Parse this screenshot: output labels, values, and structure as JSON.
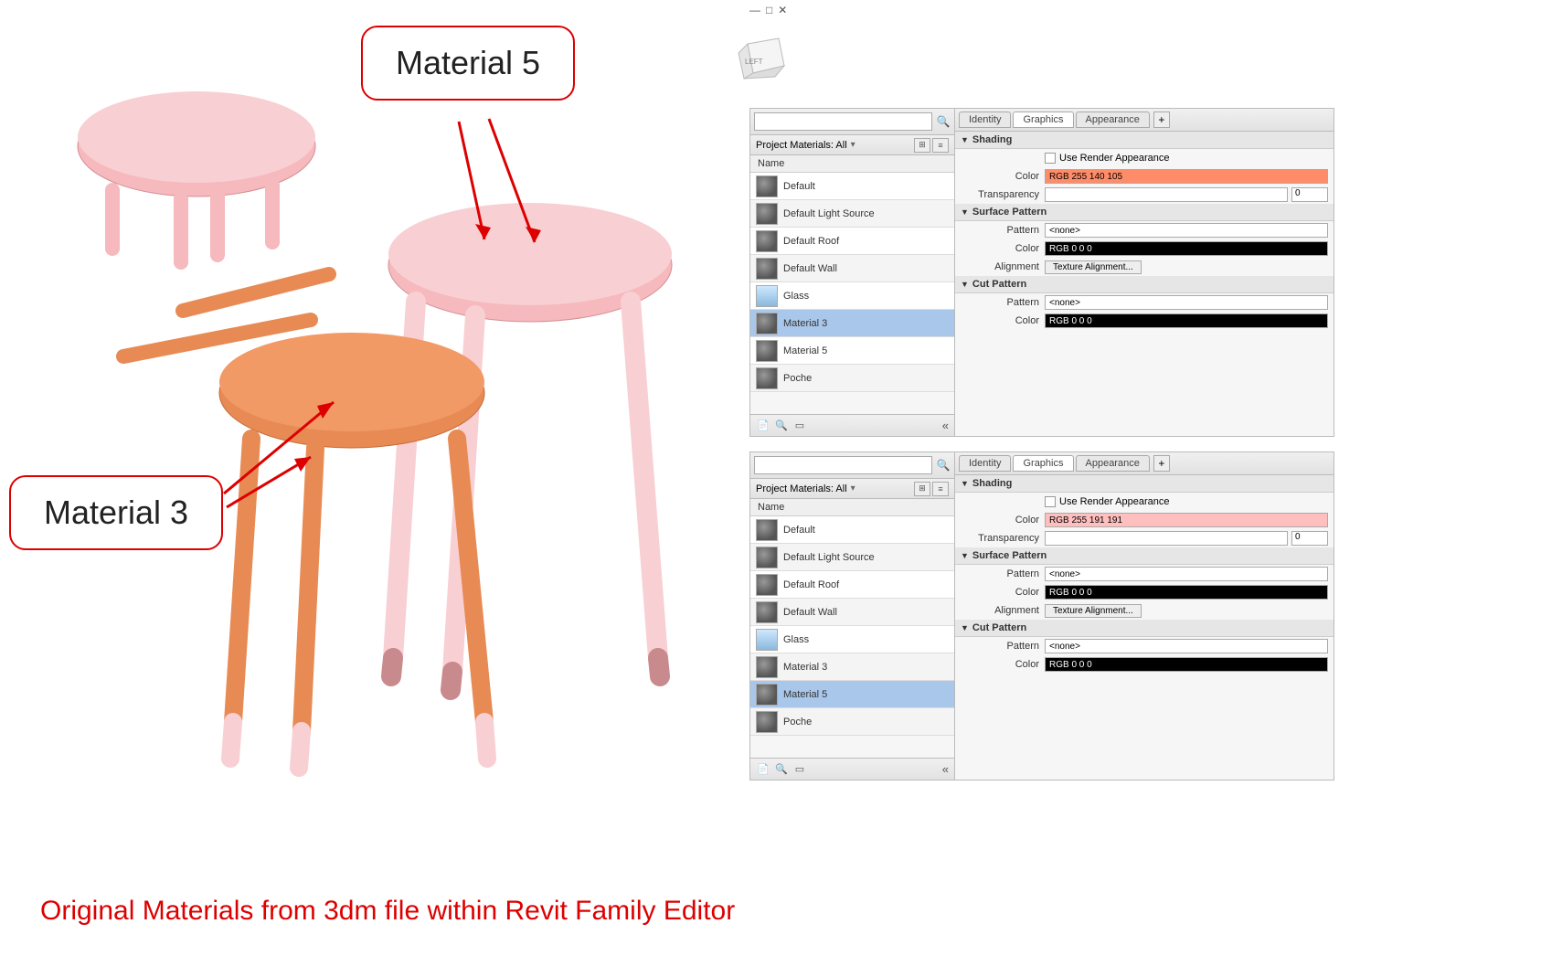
{
  "callouts": {
    "mat5": "Material 5",
    "mat3": "Material 3"
  },
  "caption": "Original Materials from 3dm file within Revit Family Editor",
  "window_ctrls": [
    "—",
    "□",
    "✕"
  ],
  "viewcube": {
    "face": "LEFT"
  },
  "search": {
    "placeholder": ""
  },
  "filter": {
    "label": "Project Materials: All",
    "chev": "▾"
  },
  "list_header": "Name",
  "materials": [
    {
      "name": "Default",
      "sw": "sphere"
    },
    {
      "name": "Default Light Source",
      "sw": "sphere"
    },
    {
      "name": "Default Roof",
      "sw": "sphere"
    },
    {
      "name": "Default Wall",
      "sw": "sphere"
    },
    {
      "name": "Glass",
      "sw": "glass"
    },
    {
      "name": "Material 3",
      "sw": "sphere"
    },
    {
      "name": "Material 5",
      "sw": "sphere"
    },
    {
      "name": "Poche",
      "sw": "sphere"
    }
  ],
  "tabs": {
    "identity": "Identity",
    "graphics": "Graphics",
    "appearance": "Appearance"
  },
  "sections": {
    "shading": "Shading",
    "use_render": "Use Render Appearance",
    "color": "Color",
    "transparency": "Transparency",
    "surface_pattern": "Surface Pattern",
    "pattern": "Pattern",
    "none": "<none>",
    "alignment": "Alignment",
    "tex_align": "Texture Alignment...",
    "cut_pattern": "Cut Pattern",
    "black": "RGB 0 0 0"
  },
  "panel1": {
    "selected_index": 5,
    "color_text": "RGB 255 140 105",
    "color_hex": "#ff8c69",
    "transparency": "0"
  },
  "panel2": {
    "selected_index": 6,
    "color_text": "RGB 255 191 191",
    "color_hex": "#ffbfbf",
    "transparency": "0"
  },
  "collapse": "«",
  "search_icon": "🔍"
}
